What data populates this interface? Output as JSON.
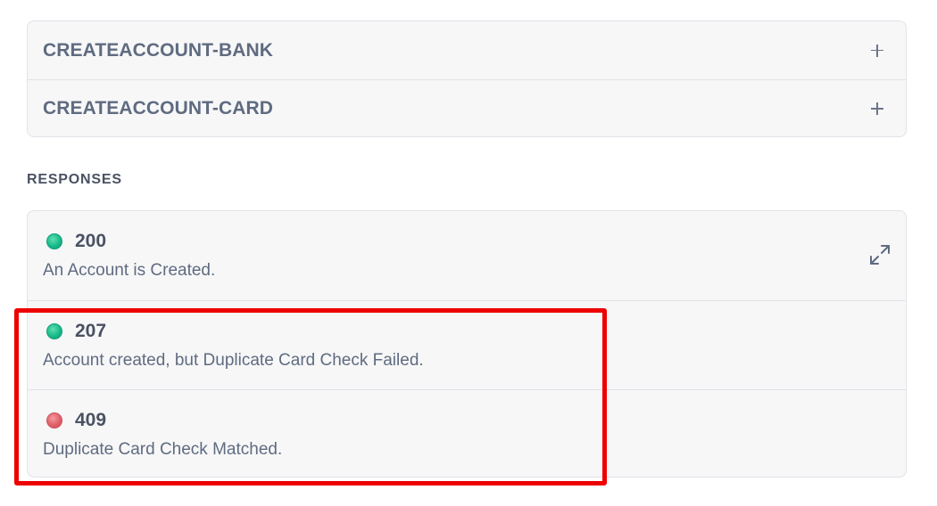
{
  "accordion": {
    "items": [
      {
        "label": "CREATEACCOUNT-BANK",
        "icon": "plus-icon"
      },
      {
        "label": "CREATEACCOUNT-CARD",
        "icon": "plus-icon"
      }
    ]
  },
  "responses": {
    "label": "RESPONSES",
    "items": [
      {
        "code": "200",
        "description": "An Account is Created.",
        "status": "success",
        "color": "#18b98a"
      },
      {
        "code": "207",
        "description": "Account created, but Duplicate Card Check Failed.",
        "status": "success",
        "color": "#18b98a"
      },
      {
        "code": "409",
        "description": "Duplicate Card Check Matched.",
        "status": "error",
        "color": "#e0606a"
      }
    ],
    "expand_icon": "expand-icon"
  },
  "highlight": {
    "color": "#ee0000"
  }
}
